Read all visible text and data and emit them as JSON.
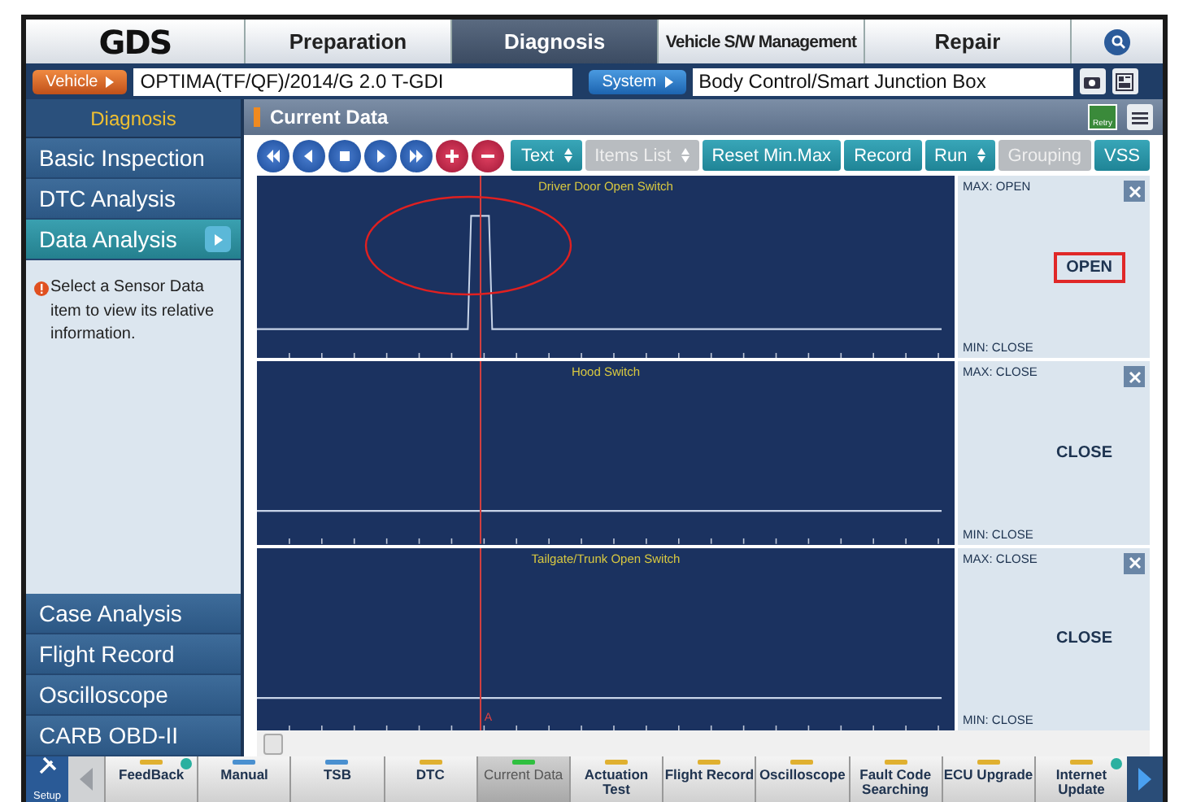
{
  "logo": "GDS",
  "nav_tabs": [
    {
      "label": "Preparation",
      "selected": false
    },
    {
      "label": "Diagnosis",
      "selected": true
    },
    {
      "label": "Vehicle S/W Management",
      "selected": false
    },
    {
      "label": "Repair",
      "selected": false
    }
  ],
  "vehicle_bar": {
    "vehicle_button": "Vehicle",
    "vehicle": "OPTIMA(TF/QF)/2014/G 2.0 T-GDI",
    "system_button": "System",
    "system": "Body Control/Smart Junction Box"
  },
  "sidebar": {
    "header": "Diagnosis",
    "top_items": [
      {
        "label": "Basic Inspection",
        "selected": false
      },
      {
        "label": "DTC Analysis",
        "selected": false
      },
      {
        "label": "Data Analysis",
        "selected": true
      }
    ],
    "info": "Select a Sensor Data item to view its relative information.",
    "bottom_items": [
      {
        "label": "Case Analysis",
        "selected": false
      },
      {
        "label": "Flight Record",
        "selected": false
      },
      {
        "label": "Oscilloscope",
        "selected": false
      },
      {
        "label": "CARB OBD-II",
        "selected": false
      }
    ]
  },
  "panel": {
    "title": "Current Data",
    "retry_label": "Retry"
  },
  "toolbar": {
    "media": [
      {
        "kind": "rewind"
      },
      {
        "kind": "back"
      },
      {
        "kind": "stop"
      },
      {
        "kind": "play"
      },
      {
        "kind": "forward"
      },
      {
        "kind": "add"
      },
      {
        "kind": "remove"
      }
    ],
    "buttons": [
      {
        "label": "Text",
        "dropdown": true,
        "disabled": false
      },
      {
        "label": "Items List",
        "dropdown": true,
        "disabled": true
      },
      {
        "label": "Reset Min.Max",
        "dropdown": false,
        "disabled": false
      },
      {
        "label": "Record",
        "dropdown": false,
        "disabled": false
      },
      {
        "label": "Run",
        "dropdown": true,
        "disabled": false
      },
      {
        "label": "Grouping",
        "dropdown": false,
        "disabled": true
      },
      {
        "label": "VSS",
        "dropdown": false,
        "disabled": false
      }
    ]
  },
  "charts": [
    {
      "name": "Driver Door Open Switch",
      "kind": "pulse",
      "max": "MAX: OPEN",
      "min": "MIN: CLOSE",
      "value": "OPEN",
      "highlighted": true
    },
    {
      "name": "Hood Switch",
      "kind": "flat",
      "max": "MAX: CLOSE",
      "min": "MIN: CLOSE",
      "value": "CLOSE",
      "highlighted": false
    },
    {
      "name": "Tailgate/Trunk Open Switch",
      "kind": "flat",
      "max": "MAX: CLOSE",
      "min": "MIN: CLOSE",
      "value": "CLOSE",
      "highlighted": false
    }
  ],
  "cursor_label": "A",
  "bottom_bar": {
    "setup": "Setup",
    "items": [
      {
        "label": "FeedBack",
        "color": "#e0b030",
        "selected": false,
        "info": true
      },
      {
        "label": "Manual",
        "color": "#4a90d0",
        "selected": false,
        "info": false
      },
      {
        "label": "TSB",
        "color": "#4a90d0",
        "selected": false,
        "info": false
      },
      {
        "label": "DTC",
        "color": "#e0b030",
        "selected": false,
        "info": false
      },
      {
        "label": "Current Data",
        "color": "#30c040",
        "selected": true,
        "info": false
      },
      {
        "label": "Actuation Test",
        "color": "#e0b030",
        "selected": false,
        "info": false
      },
      {
        "label": "Flight Record",
        "color": "#e0b030",
        "selected": false,
        "info": false
      },
      {
        "label": "Oscilloscope",
        "color": "#e0b030",
        "selected": false,
        "info": false
      },
      {
        "label": "Fault Code Searching",
        "color": "#e0b030",
        "selected": false,
        "info": false
      },
      {
        "label": "ECU Upgrade",
        "color": "#e0b030",
        "selected": false,
        "info": false
      },
      {
        "label": "Internet Update",
        "color": "#e0b030",
        "selected": false,
        "info": true
      }
    ]
  }
}
